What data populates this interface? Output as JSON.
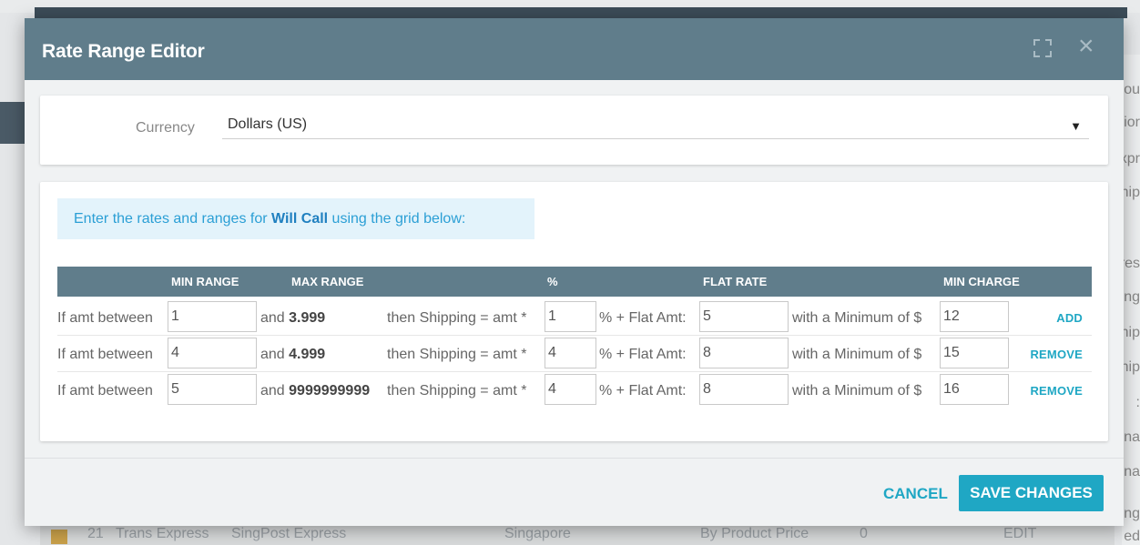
{
  "modal": {
    "title": "Rate Range Editor",
    "icons": {
      "expand": "expand-icon",
      "close": "close-icon"
    },
    "close_glyph": "×"
  },
  "currency": {
    "label": "Currency",
    "value": "Dollars (US)",
    "arrow": "▼"
  },
  "info": {
    "prefix": "Enter the rates and ranges for ",
    "method": "Will Call",
    "suffix": " using the grid below:"
  },
  "grid": {
    "headers": {
      "min_range": "MIN RANGE",
      "max_range": "MAX RANGE",
      "percent": "%",
      "flat_rate": "FLAT RATE",
      "min_charge": "MIN CHARGE"
    },
    "labels": {
      "if_between": "If amt between",
      "and": "and ",
      "then": "then Shipping = amt *",
      "plus_flat": "% + Flat Amt:",
      "with_min": "with a Minimum of $"
    },
    "rows": [
      {
        "min": "1",
        "max": "3.999",
        "percent": "1",
        "flat": "5",
        "min_charge": "12",
        "action": "ADD"
      },
      {
        "min": "4",
        "max": "4.999",
        "percent": "4",
        "flat": "8",
        "min_charge": "15",
        "action": "REMOVE"
      },
      {
        "min": "5",
        "max": "9999999999",
        "percent": "4",
        "flat": "8",
        "min_charge": "16",
        "action": "REMOVE"
      }
    ]
  },
  "footer": {
    "cancel": "CANCEL",
    "save": "SAVE CHANGES"
  },
  "background": {
    "right_fragments": [
      "ou",
      "ior",
      "xpr",
      "hip",
      "res",
      "ng",
      "hip",
      "hip",
      ":",
      "na",
      "na",
      "ng",
      "ed"
    ],
    "bottom_row": {
      "num": "21",
      "name": "Trans Express",
      "service": "SingPost Express",
      "country": "Singapore",
      "basis": "By Product Price",
      "count": "0",
      "edit": "EDIT"
    }
  },
  "colors": {
    "header": "#607d8b",
    "accent": "#1fa7c4",
    "info_bg": "#e3f3fb",
    "info_text": "#2b9fd5"
  }
}
